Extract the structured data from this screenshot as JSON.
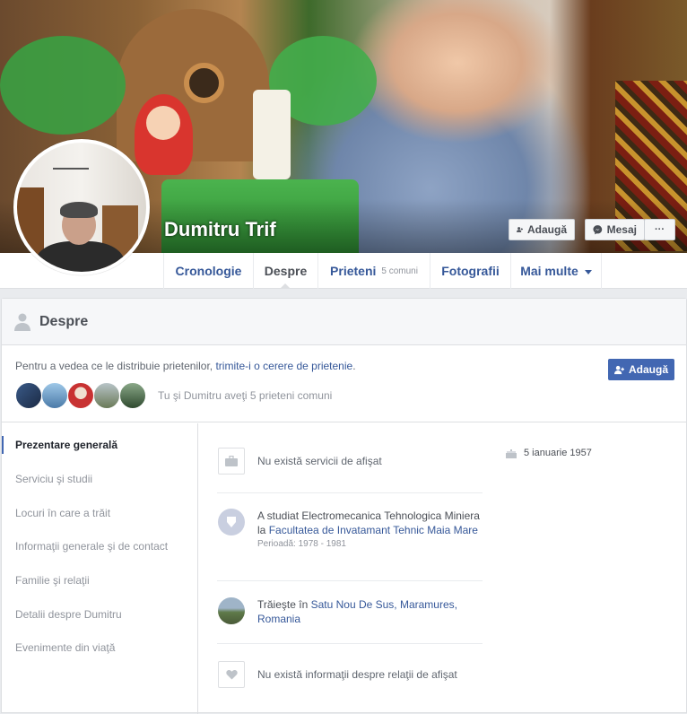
{
  "profile": {
    "name": "Dumitru Trif"
  },
  "cover_actions": {
    "add_friend": "Adaugă",
    "message": "Mesaj",
    "more": "···"
  },
  "nav": {
    "tabs": [
      {
        "label": "Cronologie"
      },
      {
        "label": "Despre"
      },
      {
        "label": "Prieteni",
        "sub": "5 comuni"
      },
      {
        "label": "Fotografii"
      },
      {
        "label": "Mai multe"
      }
    ]
  },
  "about": {
    "title": "Despre",
    "friend_prompt_pre": "Pentru a vedea ce le distribuie prietenilor, ",
    "friend_prompt_link": "trimite-i o cerere de prietenie",
    "friend_prompt_post": ".",
    "add_button": "Adaugă",
    "mutual_text": "Tu şi Dumitru aveţi 5 prieteni comuni",
    "mutual_avatars": [
      "#3a5a88",
      "#6aa0c8",
      "#c83232",
      "#8a9a78",
      "#4a6a4a"
    ]
  },
  "sidebar": {
    "items": [
      {
        "label": "Prezentare generală",
        "active": true
      },
      {
        "label": "Serviciu şi studii"
      },
      {
        "label": "Locuri în care a trăit"
      },
      {
        "label": "Informaţii generale şi de contact"
      },
      {
        "label": "Familie şi relaţii"
      },
      {
        "label": "Detalii despre Dumitru"
      },
      {
        "label": "Evenimente din viaţă"
      }
    ]
  },
  "overview": {
    "work": "Nu există servicii de afişat",
    "education_pre": "A studiat Electromecanica Tehnologica Miniera la ",
    "education_link": "Facultatea de Invatamant Tehnic Maia Mare",
    "education_period": "Perioadă: 1978 - 1981",
    "lives_pre": "Trăieşte în ",
    "lives_link": "Satu Nou De Sus, Maramures, Romania",
    "relationship": "Nu există informaţii despre relaţii de afişat",
    "birthday": "5 ianuarie 1957"
  }
}
